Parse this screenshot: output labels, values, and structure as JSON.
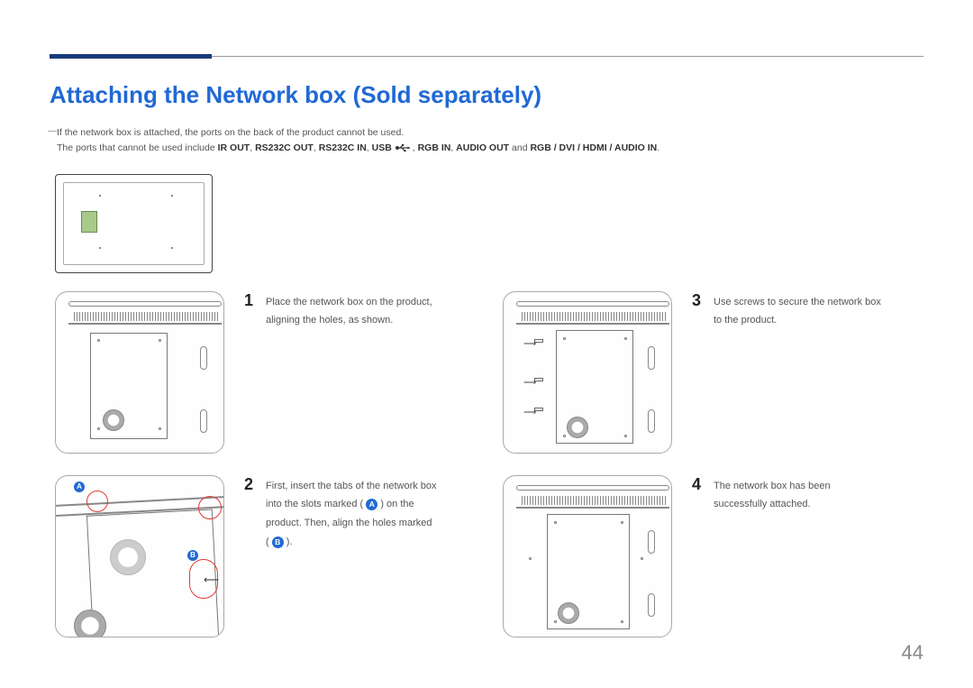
{
  "page_number": "44",
  "title": "Attaching the Network box (Sold separately)",
  "note": {
    "line1": "If the network box is attached, the ports on the back of the product cannot be used.",
    "line2_prefix": "The ports that cannot be used include ",
    "ports": [
      "IR OUT",
      "RS232C OUT",
      "RS232C IN",
      "USB"
    ],
    "ports_after_usb": [
      "RGB IN",
      "AUDIO OUT"
    ],
    "line2_and": " and ",
    "ports_last": "RGB / DVI / HDMI / AUDIO IN",
    "line2_period": "."
  },
  "steps": [
    {
      "num": "1",
      "text": "Place the network box on the product, aligning the holes, as shown."
    },
    {
      "num": "3",
      "text": "Use screws to secure the network box to the product."
    },
    {
      "num": "2",
      "text_before_a": "First, insert the tabs of the network box into the slots marked ( ",
      "label_a": "A",
      "text_between": " ) on the product. Then, align the holes marked ( ",
      "label_b": "B",
      "text_after_b": " )."
    },
    {
      "num": "4",
      "text": "The network box has been successfully attached."
    }
  ]
}
